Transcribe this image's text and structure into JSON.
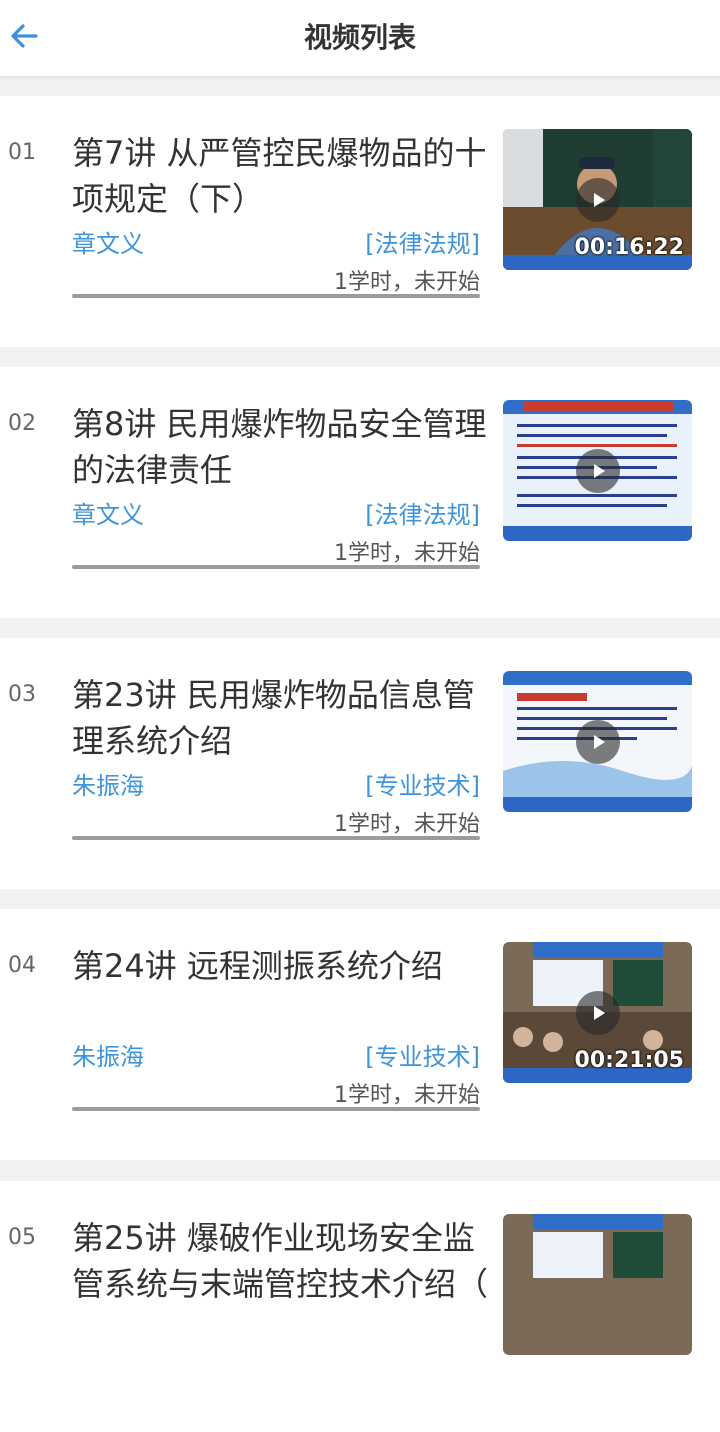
{
  "header": {
    "title": "视频列表",
    "back_icon": "arrow-left-icon"
  },
  "colors": {
    "accent": "#3f95db",
    "progress_bar": "#9b9b9b"
  },
  "videos": [
    {
      "number": "01",
      "title": "第7讲 从严管控民爆物品的十项规定（下）",
      "teacher": "章文义",
      "category": "[法律法规]",
      "status": "1学时，未开始",
      "duration": "00:16:22"
    },
    {
      "number": "02",
      "title": "第8讲 民用爆炸物品安全管理的法律责任",
      "teacher": "章文义",
      "category": "[法律法规]",
      "status": "1学时，未开始",
      "duration": ""
    },
    {
      "number": "03",
      "title": "第23讲 民用爆炸物品信息管理系统介绍",
      "teacher": "朱振海",
      "category": "[专业技术]",
      "status": "1学时，未开始",
      "duration": ""
    },
    {
      "number": "04",
      "title": "第24讲 远程测振系统介绍",
      "teacher": "朱振海",
      "category": "[专业技术]",
      "status": "1学时，未开始",
      "duration": "00:21:05"
    },
    {
      "number": "05",
      "title": "第25讲 爆破作业现场安全监管系统与末端管控技术介绍（",
      "teacher": "",
      "category": "",
      "status": "",
      "duration": ""
    }
  ]
}
